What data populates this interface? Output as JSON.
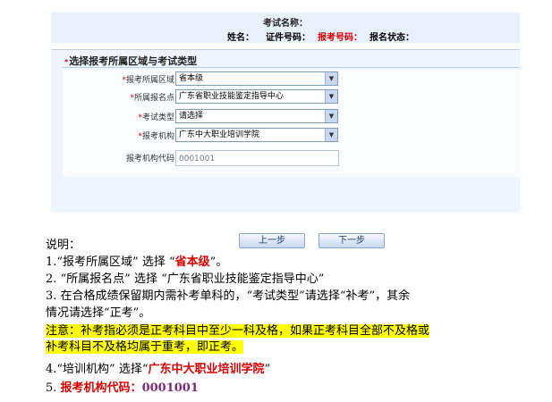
{
  "header": {
    "title": "考试名称：",
    "name_label": "姓名：",
    "id_label": "证件号码：",
    "reg_label": "报考号码：",
    "status_label": "报名状态："
  },
  "form": {
    "section_title": "选择报考所属区域与考试类型",
    "region": {
      "label": "报考所属区域",
      "value": "省本级"
    },
    "point": {
      "label": "所属报名点",
      "value": "广东省职业技能鉴定指导中心"
    },
    "exam_type": {
      "label": "考试类型",
      "value": "请选择"
    },
    "agency": {
      "label": "报考机构",
      "value": "广东中大职业培训学院"
    },
    "code": {
      "label": "报考机构代码",
      "value": "0001001"
    },
    "prev_button": "上一步",
    "next_button": "下一步",
    "required_mark": "*",
    "dropdown_arrow": "▼"
  },
  "notes": {
    "heading": "说明：",
    "n1_pre": "1.“报考所属区域” 选择  “",
    "n1_val": "省本级",
    "n1_post": "”。",
    "n2": "2.  “所属报名点” 选择 “广东省职业技能鉴定指导中心”",
    "n3a": "3.  在合格成绩保留期内需补考单科的，“考试类型”请选择“补考”，其余",
    "n3b": "情况请选择“正考”。",
    "warn_a": "注意：补考指必须是正考科目中至少一科及格，如果正考科目全部不及格或",
    "warn_b": "补考科目不及格均属于重考，即正考。",
    "n4_pre": "4.“培训机构” 选择“",
    "n4_val": "广东中大职业培训学院",
    "n4_post": "”",
    "n5_num": "5.",
    "n5_label": "报考机构代码：",
    "n5_val": "0001001"
  }
}
